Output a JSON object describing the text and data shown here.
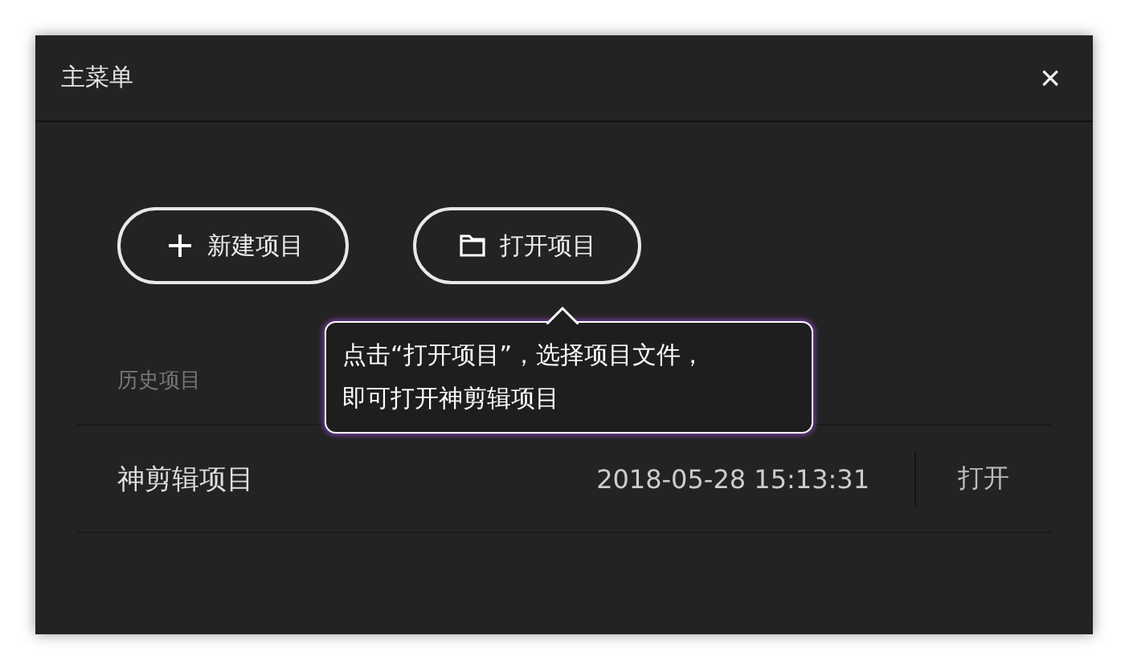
{
  "window": {
    "title": "主菜单",
    "close": "×"
  },
  "buttons": [
    {
      "kind": "new",
      "label": "新建项目"
    },
    {
      "kind": "open",
      "label": "打开项目"
    }
  ],
  "tooltip": {
    "text": "点击“打开项目”，选择项目文件，即可打开神剪辑项目"
  },
  "history": {
    "heading": "历史项目",
    "rows": [
      {
        "name": "神剪辑项目",
        "time": "2018-05-28 15:13:31",
        "action": "打开"
      }
    ]
  }
}
